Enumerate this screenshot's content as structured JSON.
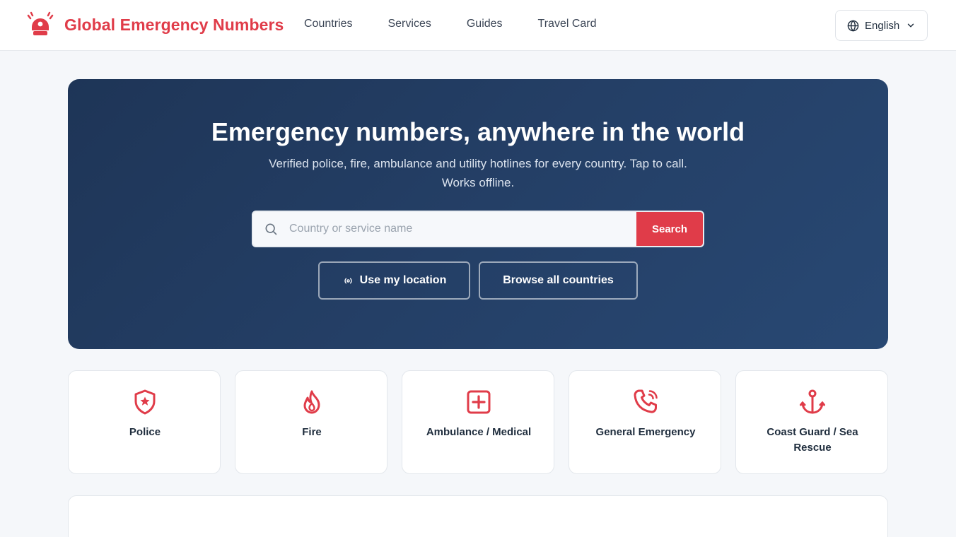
{
  "colors": {
    "accent": "#e03c49",
    "hero_bg": "#243f66",
    "text_dark": "#1f2d3d"
  },
  "brand": {
    "name": "Global Emergency Numbers",
    "icon": "alarm-siren-icon"
  },
  "nav": {
    "items": [
      "Countries",
      "Services",
      "Guides",
      "Travel Card"
    ]
  },
  "language": {
    "selected": "English",
    "icon": "globe-icon"
  },
  "hero": {
    "title": "Emergency numbers, anywhere in the world",
    "subtitle": "Verified police, fire, ambulance and utility hotlines for every country. Tap to call. Works offline.",
    "search": {
      "placeholder": "Country or service name",
      "value": "",
      "button": "Search"
    },
    "location_button": "Use my location",
    "browse_button": "Browse all countries"
  },
  "services": [
    {
      "label": "Police",
      "icon": "shield-star-icon"
    },
    {
      "label": "Fire",
      "icon": "flame-icon"
    },
    {
      "label": "Ambulance / Medical",
      "icon": "medical-plus-icon"
    },
    {
      "label": "General Emergency",
      "icon": "phone-ringing-icon"
    },
    {
      "label": "Coast Guard / Sea Rescue",
      "icon": "anchor-icon"
    }
  ]
}
